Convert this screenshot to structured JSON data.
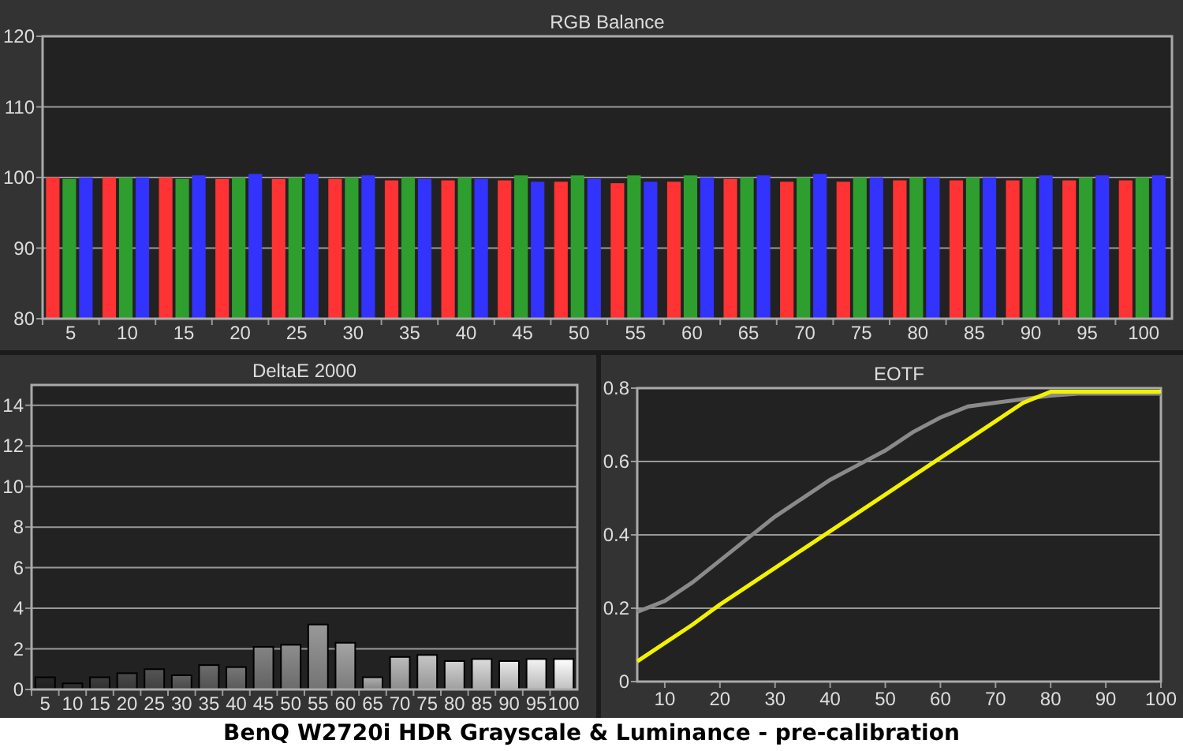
{
  "rgb_balance": {
    "chart_data": {
      "type": "bar",
      "title": "RGB Balance",
      "categories": [
        "5",
        "10",
        "15",
        "20",
        "25",
        "30",
        "35",
        "40",
        "45",
        "50",
        "55",
        "60",
        "65",
        "70",
        "75",
        "80",
        "85",
        "90",
        "95",
        "100"
      ],
      "series": [
        {
          "color": "#ff3333",
          "values": [
            100,
            100,
            100,
            99.8,
            99.8,
            99.8,
            99.6,
            99.6,
            99.6,
            99.4,
            99.2,
            99.4,
            99.8,
            99.4,
            99.4,
            99.6,
            99.6,
            99.6,
            99.6,
            99.6
          ]
        },
        {
          "color": "#2e9e2e",
          "values": [
            99.8,
            100,
            99.8,
            100,
            100,
            100,
            100,
            100,
            100.3,
            100.3,
            100.3,
            100.3,
            100,
            100,
            100,
            100,
            100,
            100,
            100,
            100
          ]
        },
        {
          "color": "#3333ff",
          "values": [
            100,
            100,
            100.3,
            100.5,
            100.5,
            100.3,
            99.8,
            99.8,
            99.4,
            99.8,
            99.4,
            100,
            100.3,
            100.5,
            100,
            100,
            100,
            100.3,
            100.3,
            100.3
          ]
        }
      ],
      "ylim": [
        80,
        120
      ],
      "yticks": [
        80,
        90,
        100,
        110,
        120
      ],
      "grid": true
    }
  },
  "deltae": {
    "chart_data": {
      "type": "bar",
      "title": "DeltaE 2000",
      "categories": [
        "5",
        "10",
        "15",
        "20",
        "25",
        "30",
        "35",
        "40",
        "45",
        "50",
        "55",
        "60",
        "65",
        "70",
        "75",
        "80",
        "85",
        "90",
        "95",
        "100"
      ],
      "values": [
        0.6,
        0.3,
        0.6,
        0.8,
        1.0,
        0.7,
        1.2,
        1.1,
        2.1,
        2.2,
        3.2,
        2.3,
        0.6,
        1.6,
        1.7,
        1.4,
        1.5,
        1.4,
        1.5,
        1.5
      ],
      "ylim": [
        0,
        15
      ],
      "yticks": [
        0,
        2,
        4,
        6,
        8,
        10,
        12,
        14
      ],
      "grid": true
    }
  },
  "eotf": {
    "chart_data": {
      "type": "line",
      "title": "EOTF",
      "x": [
        5,
        10,
        15,
        20,
        25,
        30,
        35,
        40,
        45,
        50,
        55,
        60,
        65,
        70,
        75,
        80,
        85,
        90,
        95,
        100
      ],
      "series": [
        {
          "color": "#8a8a8a",
          "values": [
            0.19,
            0.22,
            0.27,
            0.33,
            0.39,
            0.45,
            0.5,
            0.55,
            0.59,
            0.63,
            0.68,
            0.72,
            0.75,
            0.76,
            0.77,
            0.78,
            0.785,
            0.785,
            0.785,
            0.785
          ]
        },
        {
          "color": "#f2f200",
          "values": [
            0.055,
            0.105,
            0.155,
            0.21,
            0.26,
            0.31,
            0.36,
            0.41,
            0.46,
            0.51,
            0.56,
            0.61,
            0.66,
            0.71,
            0.76,
            0.79,
            0.79,
            0.79,
            0.79,
            0.79
          ]
        }
      ],
      "xlim": [
        5,
        100
      ],
      "ylim": [
        0,
        0.8
      ],
      "xticks": [
        10,
        20,
        30,
        40,
        50,
        60,
        70,
        80,
        90,
        100
      ],
      "yticks": [
        0,
        0.2,
        0.4,
        0.6,
        0.8
      ],
      "grid": true
    }
  },
  "caption": "BenQ W2720i HDR Grayscale & Luminance - pre-calibration"
}
